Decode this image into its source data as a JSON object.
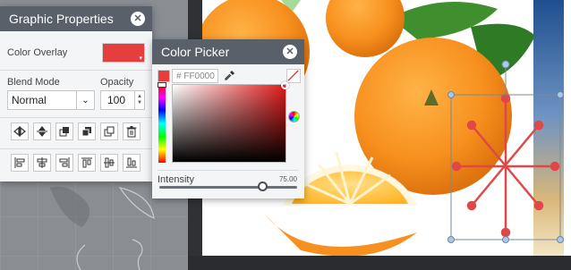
{
  "graphic_properties": {
    "title": "Graphic Properties",
    "color_overlay_label": "Color Overlay",
    "overlay_color": "#e53e3e",
    "blend_mode_label": "Blend Mode",
    "blend_mode_value": "Normal",
    "opacity_label": "Opacity",
    "opacity_value": "100",
    "tool_row1_icons": [
      "flip-horizontal-icon",
      "flip-vertical-icon",
      "bring-forward-icon",
      "send-backward-icon",
      "duplicate-icon",
      "delete-icon"
    ],
    "tool_row2_icons": [
      "align-left-icon",
      "align-center-icon",
      "align-right-icon",
      "align-top-icon",
      "align-middle-icon",
      "align-bottom-icon"
    ]
  },
  "color_picker": {
    "title": "Color Picker",
    "current_color": "#ff0000",
    "hex_value": "# FF0000",
    "intensity_label": "Intensity",
    "intensity_value": "75.00",
    "intensity_fraction": 0.75
  }
}
